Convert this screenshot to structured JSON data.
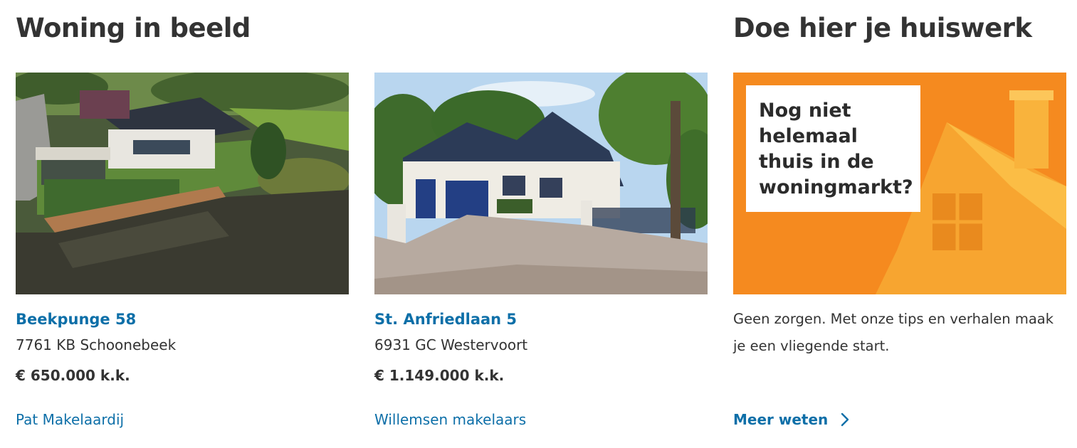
{
  "sections": {
    "left_title": "Woning in beeld",
    "right_title": "Doe hier je huiswerk"
  },
  "listings": [
    {
      "address": "Beekpunge 58",
      "postal": "7761 KB Schoonebeek",
      "price": "€ 650.000 k.k.",
      "agent": "Pat Makelaardij"
    },
    {
      "address": "St. Anfriedlaan 5",
      "postal": "6931 GC Westervoort",
      "price": "€ 1.149.000 k.k.",
      "agent": "Willemsen makelaars"
    }
  ],
  "promo": {
    "image_text": "Nog niet\nhelemaal\nthuis in de\nwoningmarkt?",
    "description": "Geen zorgen. Met onze tips en verhalen maak je een vliegende start.",
    "link_label": "Meer weten",
    "link_icon": "chevron-right-icon"
  },
  "colors": {
    "link": "#0d6fa8",
    "text": "#333333",
    "promo_orange": "#f58a1f"
  }
}
